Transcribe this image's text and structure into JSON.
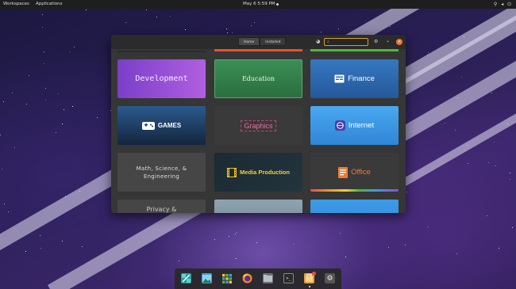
{
  "topbar": {
    "workspaces": "Workspaces",
    "applications": "Applications",
    "clock": "May 6   5:59 PM"
  },
  "window": {
    "tabs": [
      "Home",
      "Installed"
    ],
    "search_placeholder": "",
    "categories": [
      {
        "label": "Development",
        "icon": "none"
      },
      {
        "label": "Education",
        "icon": "none"
      },
      {
        "label": "Finance",
        "icon": "finance-icon"
      },
      {
        "label": "GAMES",
        "icon": "gamepad-icon"
      },
      {
        "label": "Graphics",
        "icon": "none"
      },
      {
        "label": "Internet",
        "icon": "globe-icon"
      },
      {
        "label": "Math, Science, & Engineering",
        "icon": "none"
      },
      {
        "label": "Media Production",
        "icon": "film-icon"
      },
      {
        "label": "Office",
        "icon": "document-icon"
      },
      {
        "label": "Privacy &",
        "icon": "none"
      },
      {
        "label": "",
        "icon": "none"
      },
      {
        "label": "",
        "icon": "none"
      }
    ]
  },
  "dock": {
    "apps": [
      "app-launcher",
      "photos",
      "app-grid",
      "firefox",
      "files",
      "terminal",
      "app-center",
      "settings"
    ]
  },
  "colors": {
    "accent": "#e8752a",
    "search_border": "#e0a020",
    "development": "#9a4fd6",
    "education": "#2f8a4a",
    "finance": "#2f6db2",
    "games": "#1d3a5e",
    "internet": "#3e9be6",
    "media": "#1e2a30"
  }
}
